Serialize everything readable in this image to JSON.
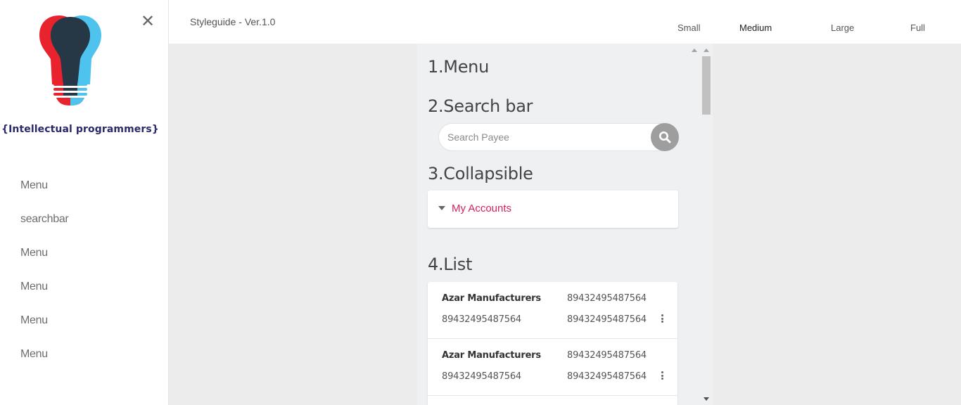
{
  "sidebar": {
    "logo_text": "{Intellectual programmers}",
    "close_symbol": "✕",
    "items": [
      {
        "label": "Menu"
      },
      {
        "label": "searchbar"
      },
      {
        "label": "Menu"
      },
      {
        "label": "Menu"
      },
      {
        "label": "Menu"
      },
      {
        "label": "Menu"
      }
    ]
  },
  "header": {
    "title": "Styleguide - Ver.1.0",
    "sizes": [
      "Small",
      "Medium",
      "Large",
      "Full"
    ],
    "active_size": "Medium"
  },
  "sections": {
    "menu_title": "1.Menu",
    "search_title": "2.Search bar",
    "collapsible_title": "3.Collapsible",
    "list_title": "4.List"
  },
  "search": {
    "placeholder": "Search Payee"
  },
  "collapsible": {
    "label": "My Accounts"
  },
  "list": {
    "rows": [
      {
        "name": "Azar Manufacturers",
        "col2_top": "89432495487564",
        "col1_bottom": "89432495487564",
        "col2_bottom": "89432495487564"
      },
      {
        "name": "Azar Manufacturers",
        "col2_top": "89432495487564",
        "col1_bottom": "89432495487564",
        "col2_bottom": "89432495487564"
      }
    ]
  },
  "colors": {
    "accent": "#d4225a",
    "logo_red": "#e8232e",
    "logo_blue": "#4ec3ee",
    "logo_dark": "#263846",
    "logo_text": "#2a2a6a"
  },
  "icons": {
    "close": "close-icon",
    "search": "search-icon",
    "caret": "caret-down-icon",
    "menu": "more-vertical-icon"
  }
}
